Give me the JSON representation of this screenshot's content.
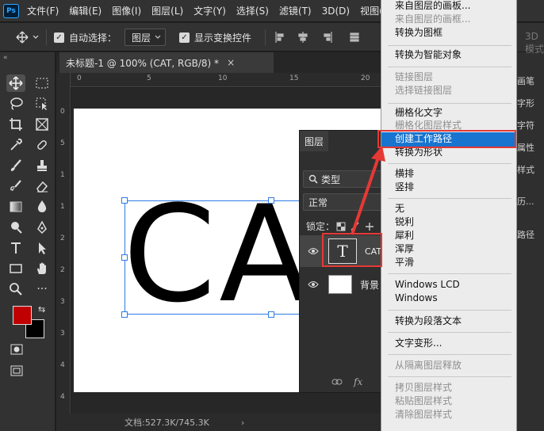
{
  "app": {
    "logo": "Ps",
    "menu": [
      "文件(F)",
      "编辑(E)",
      "图像(I)",
      "图层(L)",
      "文字(Y)",
      "选择(S)",
      "滤镜(T)",
      "3D(D)",
      "视图(V)"
    ]
  },
  "options_bar": {
    "auto_select_label": "自动选择：",
    "auto_select_value": "图层",
    "show_transform_label": "显示变换控件",
    "mode_label": "3D 模式"
  },
  "document": {
    "tab_title": "未标题-1 @ 100% (CAT, RGB/8) *",
    "canvas_text": "CAT",
    "status": "文档:527.3K/745.3K",
    "ruler_top": [
      "0",
      "5",
      "10",
      "15",
      "20"
    ],
    "ruler_left": [
      "0",
      "5",
      "1",
      "1",
      "2",
      "2",
      "3",
      "3",
      "4",
      "4",
      "5"
    ]
  },
  "layers_panel": {
    "tab": "图层",
    "filter_label": "类型",
    "blend_mode": "正常",
    "lock_label": "锁定：",
    "layers": [
      {
        "name": "CAT",
        "thumb": "T"
      },
      {
        "name": "背景"
      }
    ]
  },
  "context_menu": {
    "items": [
      {
        "label": "来自图层的画板...",
        "disabled": false
      },
      {
        "label": "来自图层的画框...",
        "disabled": true
      },
      {
        "label": "转换为图框",
        "disabled": false
      },
      {
        "label": "转换为智能对象",
        "disabled": false
      },
      {
        "label": "链接图层",
        "disabled": true
      },
      {
        "label": "选择链接图层",
        "disabled": true
      },
      {
        "label": "栅格化文字",
        "disabled": false
      },
      {
        "label": "栅格化图层样式",
        "disabled": true
      },
      {
        "label": "创建工作路径",
        "disabled": false,
        "highlighted": true
      },
      {
        "label": "转换为形状",
        "disabled": false
      },
      {
        "label": "横排",
        "disabled": false
      },
      {
        "label": "竖排",
        "disabled": false
      },
      {
        "label": "无",
        "disabled": false
      },
      {
        "label": "锐利",
        "disabled": false
      },
      {
        "label": "犀利",
        "disabled": false
      },
      {
        "label": "浑厚",
        "disabled": false
      },
      {
        "label": "平滑",
        "disabled": false
      },
      {
        "label": "Windows LCD",
        "disabled": false
      },
      {
        "label": "Windows",
        "disabled": false
      },
      {
        "label": "转换为段落文本",
        "disabled": false
      },
      {
        "label": "文字变形...",
        "disabled": false
      },
      {
        "label": "从隔离图层释放",
        "disabled": true
      },
      {
        "label": "拷贝图层样式",
        "disabled": true
      },
      {
        "label": "粘贴图层样式",
        "disabled": true
      },
      {
        "label": "清除图层样式",
        "disabled": true
      }
    ]
  },
  "right_panel": {
    "items": [
      "画笔",
      "字形",
      "字符",
      "属性",
      "样式",
      "历...",
      "路径"
    ]
  },
  "colors": {
    "foreground": "#c00000",
    "background": "#000000",
    "highlight": "#1874cf",
    "annotation": "#e53935"
  }
}
